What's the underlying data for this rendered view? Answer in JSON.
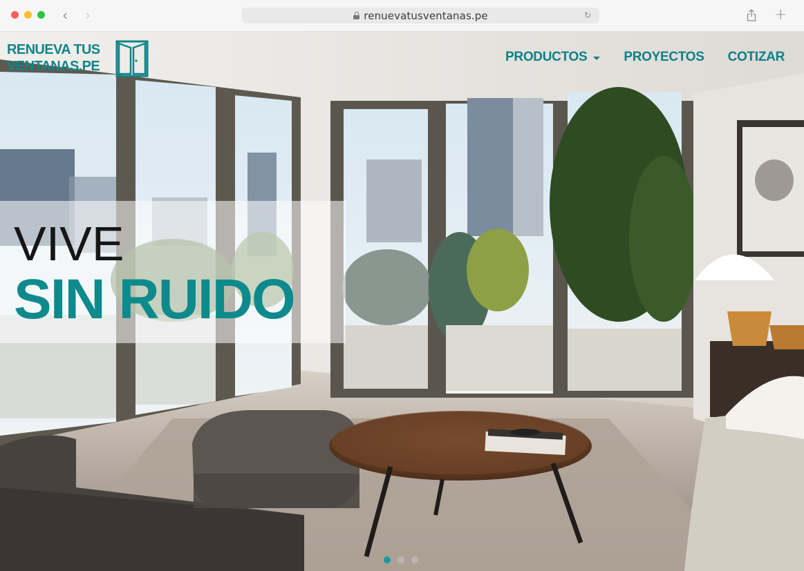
{
  "browser": {
    "url": "renuevatusventanas.pe",
    "traffic_lights": [
      "close",
      "minimize",
      "zoom"
    ],
    "back_icon": "chevron-left-icon",
    "forward_icon": "chevron-right-icon",
    "lock_icon": "lock-icon",
    "reload_icon": "reload-icon",
    "share_icon": "share-icon",
    "new_tab_icon": "plus-icon",
    "glyphs": {
      "back": "‹",
      "forward": "›",
      "reload": "↻",
      "plus": "+"
    }
  },
  "site": {
    "logo": {
      "line1": "RENUEVA TUS",
      "line2": "VENTANAS.PE",
      "icon": "double-door-icon"
    },
    "menu": [
      {
        "label": "PRODUCTOS",
        "has_dropdown": true
      },
      {
        "label": "PROYECTOS",
        "has_dropdown": false
      },
      {
        "label": "COTIZAR",
        "has_dropdown": false
      }
    ],
    "hero": {
      "line1": "VIVE",
      "line2": "SIN RUIDO",
      "slides_total": 3,
      "active_slide": 1
    }
  },
  "colors": {
    "brand_teal": "#0e8a8c",
    "menu_teal": "#0d8088",
    "dot_active": "#149aa0",
    "traffic_red": "#ff5f57",
    "traffic_yellow": "#febc2e",
    "traffic_green": "#28c840"
  }
}
